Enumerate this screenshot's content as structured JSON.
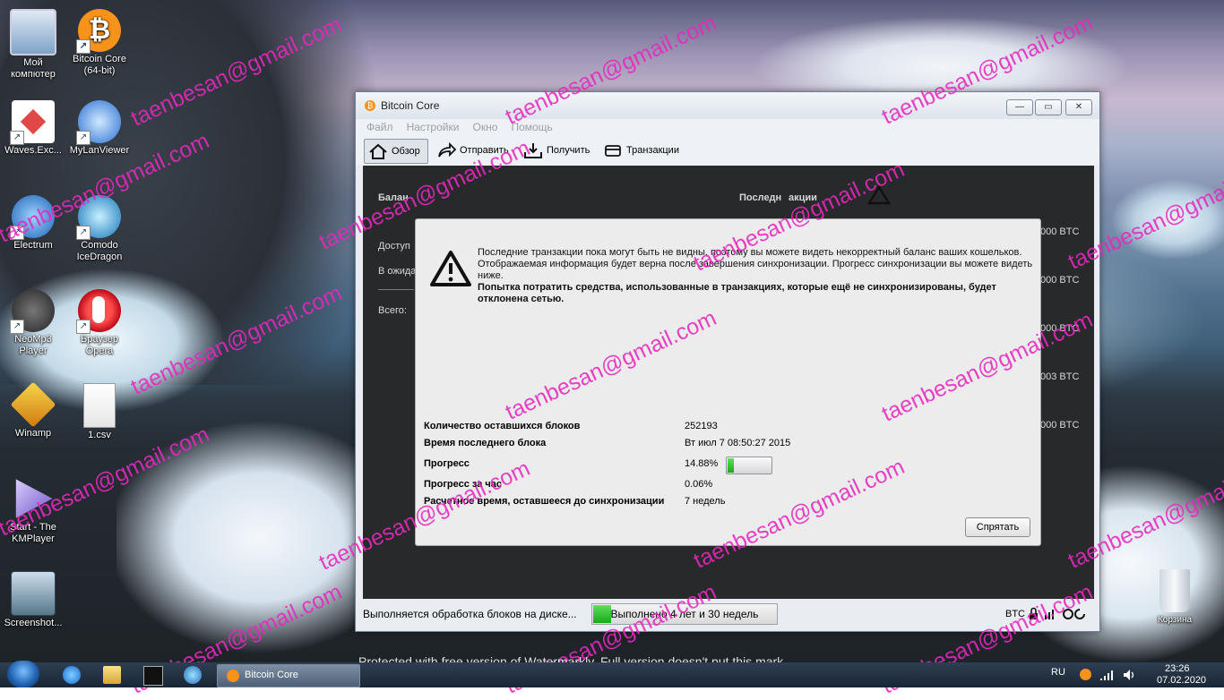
{
  "desktop": {
    "icons": [
      {
        "label": "Мой компютер"
      },
      {
        "label": "Bitcoin Core (64-bit)"
      },
      {
        "label": "Waves.Exc..."
      },
      {
        "label": "MyLanViewer"
      },
      {
        "label": "Electrum"
      },
      {
        "label": "Comodo IceDragon"
      },
      {
        "label": "NeoMp3 Player"
      },
      {
        "label": "Браузер Opera"
      },
      {
        "label": "Winamp"
      },
      {
        "label": "1.csv"
      },
      {
        "label": "Start - The KMPlayer"
      },
      {
        "label": "Screenshot..."
      },
      {
        "label": "Корзина"
      }
    ]
  },
  "window": {
    "title": "Bitcoin Core",
    "controls": {
      "minimize": "—",
      "maximize": "▭",
      "close": "✕"
    },
    "menu": [
      "Файл",
      "Настройки",
      "Окно",
      "Помощь"
    ],
    "toolbar": [
      {
        "label": "Обзор",
        "icon": "home-icon"
      },
      {
        "label": "Отправить",
        "icon": "send-icon"
      },
      {
        "label": "Получить",
        "icon": "receive-icon"
      },
      {
        "label": "Транзакции",
        "icon": "transactions-icon"
      }
    ],
    "background_labels": {
      "balances": "Балан",
      "recent": "Последн",
      "transactions_suffix": "акции",
      "available": "Доступ",
      "pending": "В ожида",
      "total": "Всего:",
      "btc_rows": [
        "000 BTC",
        "000 BTC",
        "000 BTC",
        "003 BTC",
        "000 BTC"
      ]
    },
    "status": {
      "text": "Выполняется обработка блоков на диске...",
      "progress_label": "Выполнено 4 лет и 30 недель",
      "progress_fraction": 0.1,
      "unit": "BTC"
    }
  },
  "modal": {
    "message_normal": "Последние транзакции пока могут быть не видны, поэтому вы можете видеть некорректный баланс ваших кошельков. Отображаемая информация будет верна после завершения синхронизации. Прогресс синхронизации вы можете видеть ниже.",
    "message_bold": "Попытка потратить средства, использованные в транзакциях, которые ещё не синхронизированы, будет отклонена сетью.",
    "rows": [
      {
        "key": "Количество оставшихся блоков",
        "value": "252193"
      },
      {
        "key": "Время последнего блока",
        "value": "Вт июл 7 08:50:27 2015"
      },
      {
        "key": "Прогресс",
        "value": "14.88%"
      },
      {
        "key": "Прогресс за час",
        "value": "0.06%"
      },
      {
        "key": "Расчетное время, оставшееся до синхронизации",
        "value": "7 недель"
      }
    ],
    "progress_fraction": 0.1488,
    "hide_button": "Спрятать"
  },
  "watermark": {
    "email": "taenbesan@gmail.com",
    "notice": "Protected with free version of Watermarkly. Full version doesn't put this mark."
  },
  "taskbar": {
    "task_label": "Bitcoin Core",
    "lang": "RU",
    "time": "23:26",
    "date": "07.02.2020"
  }
}
